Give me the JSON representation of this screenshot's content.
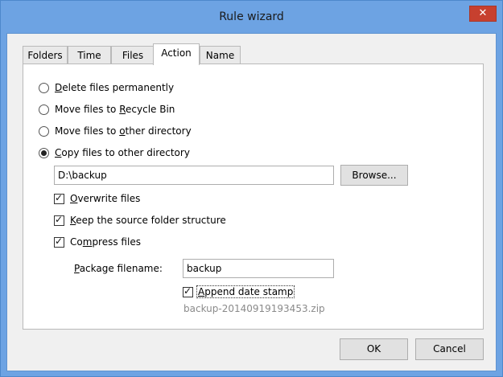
{
  "window": {
    "title": "Rule wizard",
    "close_glyph": "✕"
  },
  "tabs": [
    {
      "label": "Folders",
      "active": false
    },
    {
      "label": "Time",
      "active": false
    },
    {
      "label": "Files",
      "active": false
    },
    {
      "label": "Action",
      "active": true
    },
    {
      "label": "Name",
      "active": false
    }
  ],
  "action": {
    "options": [
      {
        "pre": "",
        "key": "D",
        "post": "elete files permanently",
        "selected": false
      },
      {
        "pre": "Move files to ",
        "key": "R",
        "post": "ecycle Bin",
        "selected": false
      },
      {
        "pre": "Move files to ",
        "key": "o",
        "post": "ther directory",
        "selected": false
      },
      {
        "pre": "",
        "key": "C",
        "post": "opy files to other directory",
        "selected": true
      }
    ],
    "target_dir": "D:\\backup",
    "browse_label": "Browse...",
    "overwrite": {
      "pre": "",
      "key": "O",
      "post": "verwrite files",
      "checked": true
    },
    "keep_structure": {
      "pre": "",
      "key": "K",
      "post": "eep the source folder structure",
      "checked": true
    },
    "compress": {
      "pre": "Co",
      "key": "m",
      "post": "press files",
      "checked": true
    },
    "package_label": {
      "pre": "",
      "key": "P",
      "post": "ackage filename:"
    },
    "package_value": "backup",
    "append_date": {
      "pre": "",
      "key": "A",
      "post": "ppend date stamp",
      "checked": true
    },
    "preview_filename": "backup-20140919193453.zip"
  },
  "footer": {
    "ok_label": "OK",
    "cancel_label": "Cancel"
  }
}
